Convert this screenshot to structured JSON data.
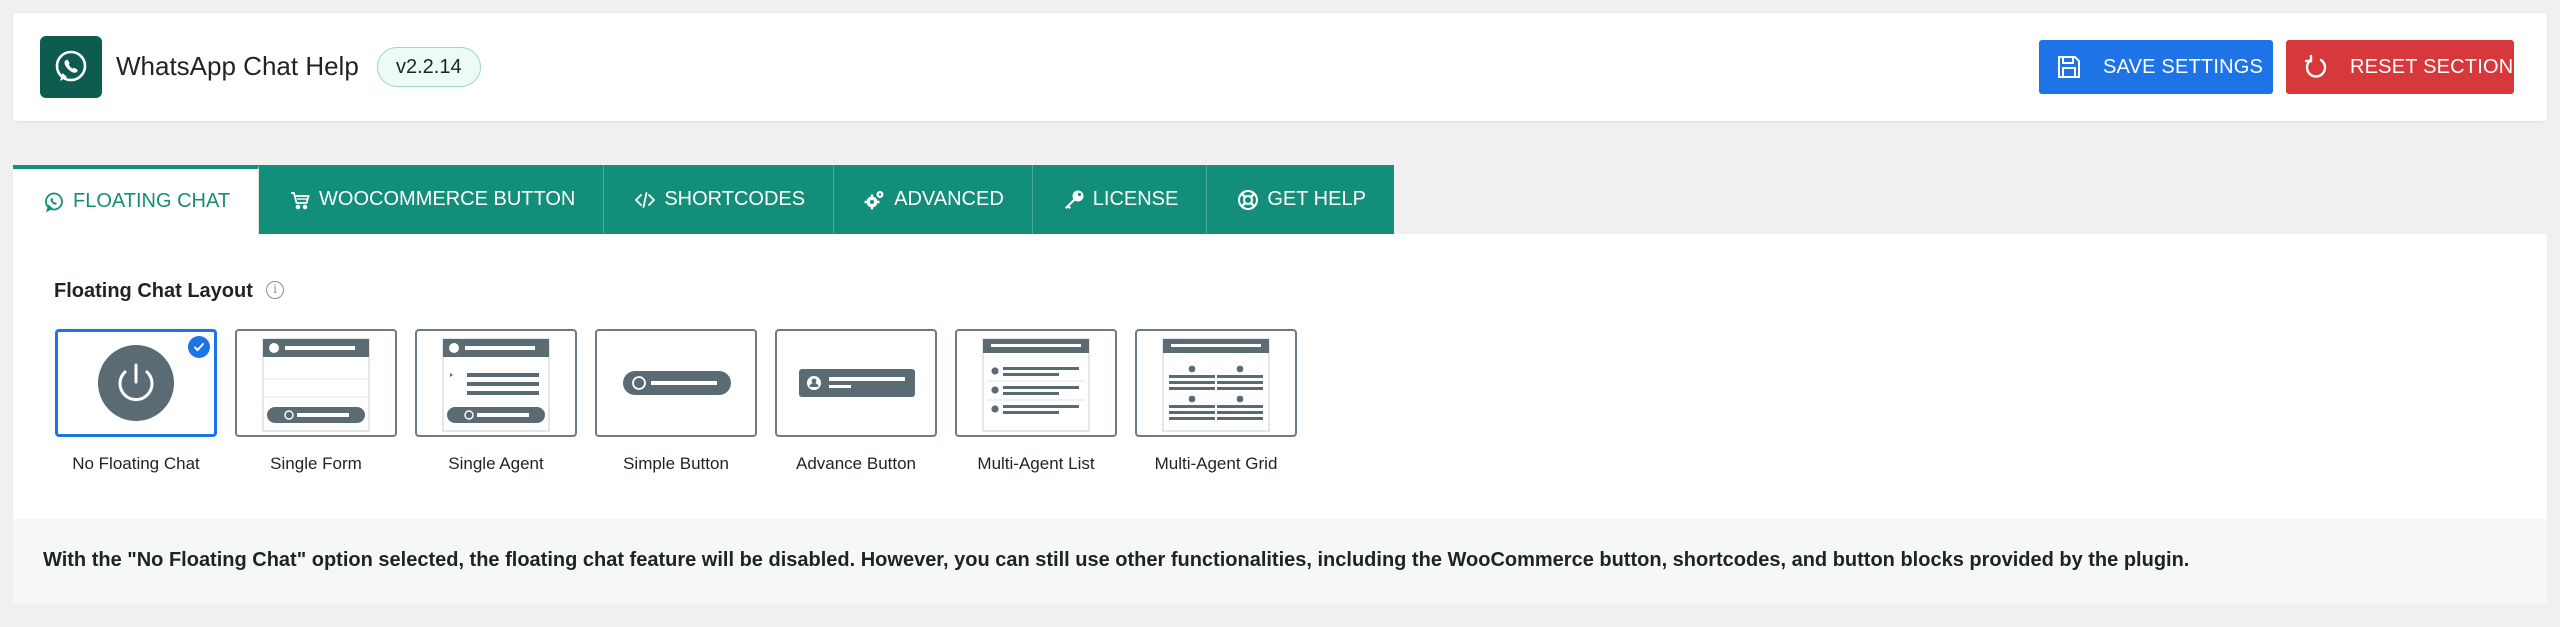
{
  "header": {
    "app_title": "WhatsApp Chat Help",
    "version": "v2.2.14",
    "logo_icon": "whatsapp-icon",
    "save_label": "SAVE SETTINGS",
    "reset_label": "RESET SECTION"
  },
  "colors": {
    "brand": "#128e7b",
    "brand_dark": "#0d5c4f",
    "save": "#1e74e6",
    "reset": "#d6383b",
    "illustration": "#5b6b74"
  },
  "tabs": [
    {
      "label": "FLOATING CHAT",
      "icon": "whatsapp-icon",
      "active": true
    },
    {
      "label": "WOOCOMMERCE BUTTON",
      "icon": "cart-icon",
      "active": false
    },
    {
      "label": "SHORTCODES",
      "icon": "code-icon",
      "active": false
    },
    {
      "label": "ADVANCED",
      "icon": "gears-icon",
      "active": false
    },
    {
      "label": "LICENSE",
      "icon": "key-icon",
      "active": false
    },
    {
      "label": "GET HELP",
      "icon": "lifebuoy-icon",
      "active": false
    }
  ],
  "panel": {
    "section_label": "Floating Chat Layout",
    "info_glyph": "i",
    "layouts": [
      {
        "name": "No Floating Chat",
        "selected": true
      },
      {
        "name": "Single Form",
        "selected": false
      },
      {
        "name": "Single Agent",
        "selected": false
      },
      {
        "name": "Simple Button",
        "selected": false
      },
      {
        "name": "Advance Button",
        "selected": false
      },
      {
        "name": "Multi-Agent List",
        "selected": false
      },
      {
        "name": "Multi-Agent Grid",
        "selected": false
      }
    ],
    "notice": "With the \"No Floating Chat\" option selected, the floating chat feature will be disabled. However, you can still use other functionalities, including the WooCommerce button, shortcodes, and button blocks provided by the plugin."
  }
}
